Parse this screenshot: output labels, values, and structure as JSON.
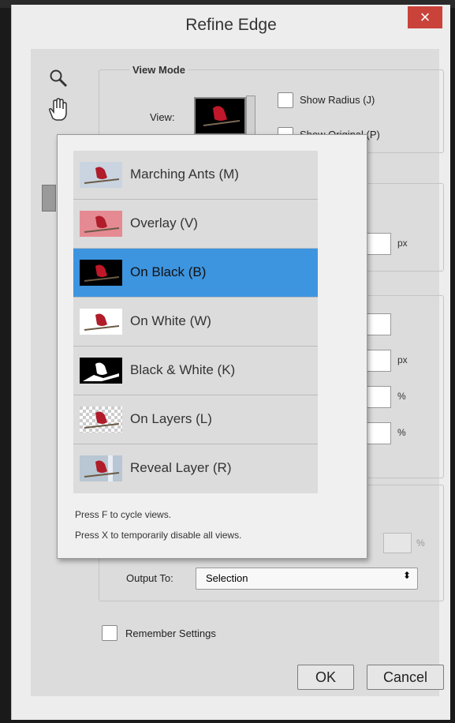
{
  "dialog": {
    "title": "Refine Edge",
    "close_icon": "×"
  },
  "view_mode": {
    "legend": "View Mode",
    "view_label": "View:",
    "show_radius": "Show Radius (J)",
    "show_original": "Show Original (P)"
  },
  "units": {
    "px1": "px",
    "px2": "px",
    "pct1": "%",
    "pct2": "%",
    "pct3": "%"
  },
  "output": {
    "label": "Output To:",
    "value": "Selection"
  },
  "remember": "Remember Settings",
  "buttons": {
    "ok": "OK",
    "cancel": "Cancel"
  },
  "view_menu": {
    "items": [
      {
        "label": "Marching Ants (M)",
        "thumb": "sky"
      },
      {
        "label": "Overlay (V)",
        "thumb": "pink"
      },
      {
        "label": "On Black (B)",
        "thumb": "black"
      },
      {
        "label": "On White (W)",
        "thumb": "white"
      },
      {
        "label": "Black & White (K)",
        "thumb": "bw"
      },
      {
        "label": "On Layers (L)",
        "thumb": "checker"
      },
      {
        "label": "Reveal Layer (R)",
        "thumb": "sky"
      }
    ],
    "selected_index": 2,
    "hint1": "Press F to cycle views.",
    "hint2": "Press X to temporarily disable all views."
  },
  "colors": {
    "selection": "#3d95e0",
    "close": "#c9433a"
  }
}
